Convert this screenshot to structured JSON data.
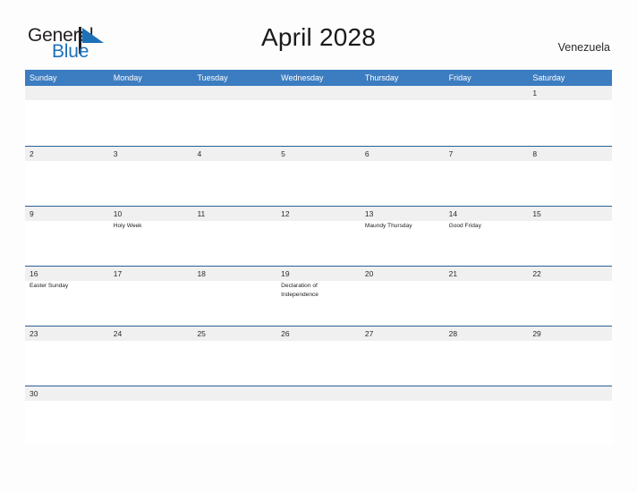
{
  "logo": {
    "word_top": "General",
    "word_bottom": "Blue",
    "flag_icon": "flag-triangle-icon",
    "top_color": "#231f20",
    "bottom_color": "#1c71b8"
  },
  "header": {
    "title": "April 2028",
    "country": "Venezuela"
  },
  "theme": {
    "header_blue": "#3c7cc0",
    "divider_blue": "#2a6099",
    "daynum_strip": "#f0f0f0",
    "page_background": "#fdfdfd",
    "text_color": "#1f1f1f"
  },
  "calendar": {
    "weekdays": [
      "Sunday",
      "Monday",
      "Tuesday",
      "Wednesday",
      "Thursday",
      "Friday",
      "Saturday"
    ],
    "weeks": [
      {
        "days": [
          {
            "num": "",
            "events": []
          },
          {
            "num": "",
            "events": []
          },
          {
            "num": "",
            "events": []
          },
          {
            "num": "",
            "events": []
          },
          {
            "num": "",
            "events": []
          },
          {
            "num": "",
            "events": []
          },
          {
            "num": "1",
            "events": []
          }
        ]
      },
      {
        "days": [
          {
            "num": "2",
            "events": []
          },
          {
            "num": "3",
            "events": []
          },
          {
            "num": "4",
            "events": []
          },
          {
            "num": "5",
            "events": []
          },
          {
            "num": "6",
            "events": []
          },
          {
            "num": "7",
            "events": []
          },
          {
            "num": "8",
            "events": []
          }
        ]
      },
      {
        "days": [
          {
            "num": "9",
            "events": []
          },
          {
            "num": "10",
            "events": [
              "Holy Week"
            ]
          },
          {
            "num": "11",
            "events": []
          },
          {
            "num": "12",
            "events": []
          },
          {
            "num": "13",
            "events": [
              "Maundy Thursday"
            ]
          },
          {
            "num": "14",
            "events": [
              "Good Friday"
            ]
          },
          {
            "num": "15",
            "events": []
          }
        ]
      },
      {
        "days": [
          {
            "num": "16",
            "events": [
              "Easter Sunday"
            ]
          },
          {
            "num": "17",
            "events": []
          },
          {
            "num": "18",
            "events": []
          },
          {
            "num": "19",
            "events": [
              "Declaration of Independence"
            ]
          },
          {
            "num": "20",
            "events": []
          },
          {
            "num": "21",
            "events": []
          },
          {
            "num": "22",
            "events": []
          }
        ]
      },
      {
        "days": [
          {
            "num": "23",
            "events": []
          },
          {
            "num": "24",
            "events": []
          },
          {
            "num": "25",
            "events": []
          },
          {
            "num": "26",
            "events": []
          },
          {
            "num": "27",
            "events": []
          },
          {
            "num": "28",
            "events": []
          },
          {
            "num": "29",
            "events": []
          }
        ]
      },
      {
        "days": [
          {
            "num": "30",
            "events": []
          },
          {
            "num": "",
            "events": []
          },
          {
            "num": "",
            "events": []
          },
          {
            "num": "",
            "events": []
          },
          {
            "num": "",
            "events": []
          },
          {
            "num": "",
            "events": []
          },
          {
            "num": "",
            "events": []
          }
        ]
      }
    ]
  }
}
